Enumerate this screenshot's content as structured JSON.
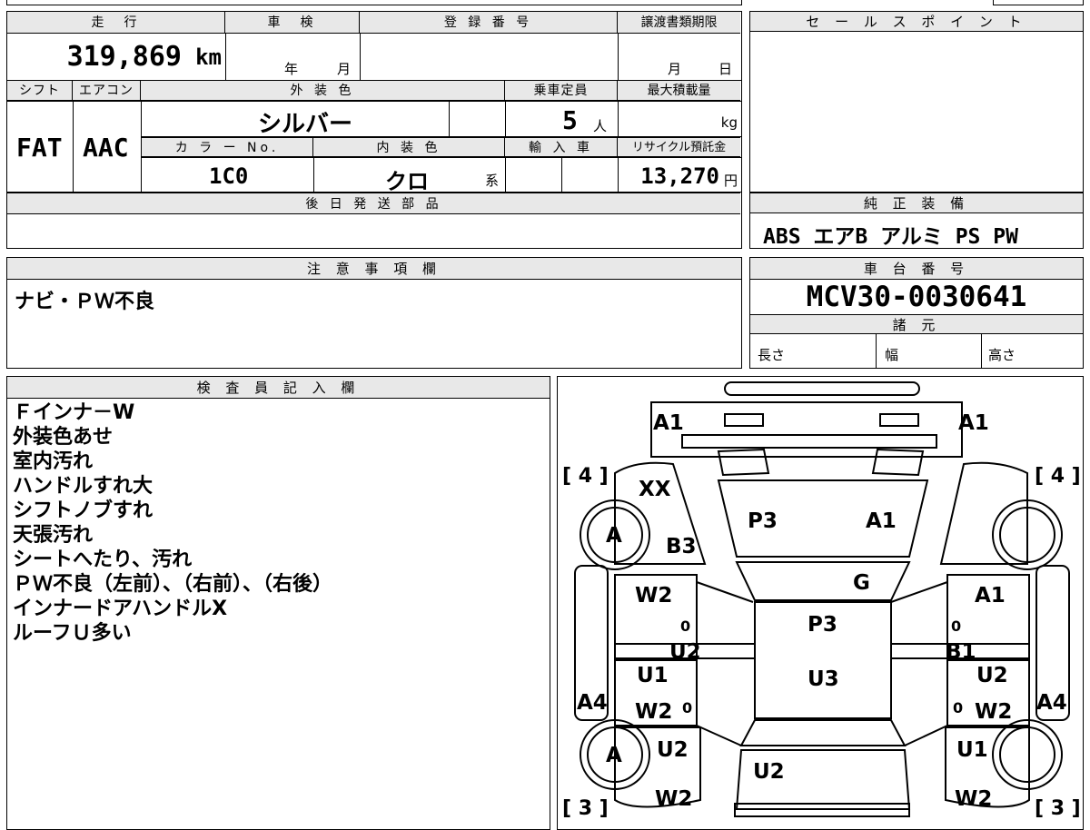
{
  "top": {
    "odometer_header": "走　行",
    "odometer_value": "319,869",
    "odometer_unit": "km",
    "shaken_header": "車　検",
    "shaken_year": "年",
    "shaken_month": "月",
    "registration_header": "登 録 番 号",
    "transfer_header": "譲渡書類期限",
    "transfer_month": "月",
    "transfer_day": "日",
    "shift_header": "シフト",
    "shift_value": "FAT",
    "ac_header": "エアコン",
    "ac_value": "AAC",
    "exterior_header": "外 装 色",
    "exterior_value": "シルバー",
    "capacity_header": "乗車定員",
    "capacity_value": "5",
    "capacity_unit": "人",
    "maxload_header": "最大積載量",
    "maxload_unit": "kg",
    "color_no_header": "カ ラ ー No.",
    "color_no_value": "1C0",
    "interior_header": "内 装 色",
    "interior_value": "クロ",
    "interior_suffix": "系",
    "import_header": "輸 入 車",
    "recycle_header": "リサイクル預託金",
    "recycle_value": "13,270",
    "recycle_unit": "円",
    "later_parts_header": "後 日 発 送 部 品"
  },
  "sales_point": {
    "header": "セ ー ル ス ポ イ ン ト"
  },
  "equipment": {
    "header": "純 正 装 備",
    "value": "ABS エアB アルミ PS PW"
  },
  "caution": {
    "header": "注 意 事 項 欄",
    "value": "ナビ・ＰＷ不良"
  },
  "chassis": {
    "header": "車 台 番 号",
    "value": "MCV30-0030641",
    "spec_header": "諸 元",
    "length": "長さ",
    "width": "幅",
    "height": "高さ"
  },
  "inspector": {
    "header": "検 査 員 記 入 欄",
    "lines": [
      "Ｆインナ－W",
      "外装色あせ",
      "室内汚れ",
      "ハンドルすれ大",
      "シフトノブすれ",
      "天張汚れ",
      "シートへたり、汚れ",
      "ＰＷ不良（左前）、（右前）、（右後）",
      "インナードアハンドルX",
      "ルーフＵ多い"
    ]
  },
  "diagram": {
    "tire_left_front": "[ 4 ]",
    "tire_right_front": "[ 4 ]",
    "tire_left_rear": "[ 3 ]",
    "tire_right_rear": "[ 3 ]",
    "marks": {
      "front_left": "A1",
      "front_right": "A1",
      "fender_left_top": "XX",
      "wheel_left_front": "A",
      "fender_left": "B3",
      "hood_left": "P3",
      "hood_right": "A1",
      "windshield": "G",
      "door_lf_top": "W2",
      "door_rf_top": "A1",
      "door_lf_zero": "0",
      "door_rf_zero": "0",
      "roof": "P3",
      "pillar_left": "U2",
      "pillar_right": "B1",
      "door_lr_1": "U1",
      "door_rr_1": "U2",
      "roof_rear": "U3",
      "sill_left": "A4",
      "sill_right": "A4",
      "door_lr_2": "W2",
      "door_rr_2": "W2",
      "door_lr_zero": "0",
      "door_rr_zero": "0",
      "wheel_left_rear": "A",
      "qtr_left": "U2",
      "qtr_right": "U1",
      "trunk": "U2",
      "rear_left": "W2",
      "rear_right": "W2"
    }
  }
}
